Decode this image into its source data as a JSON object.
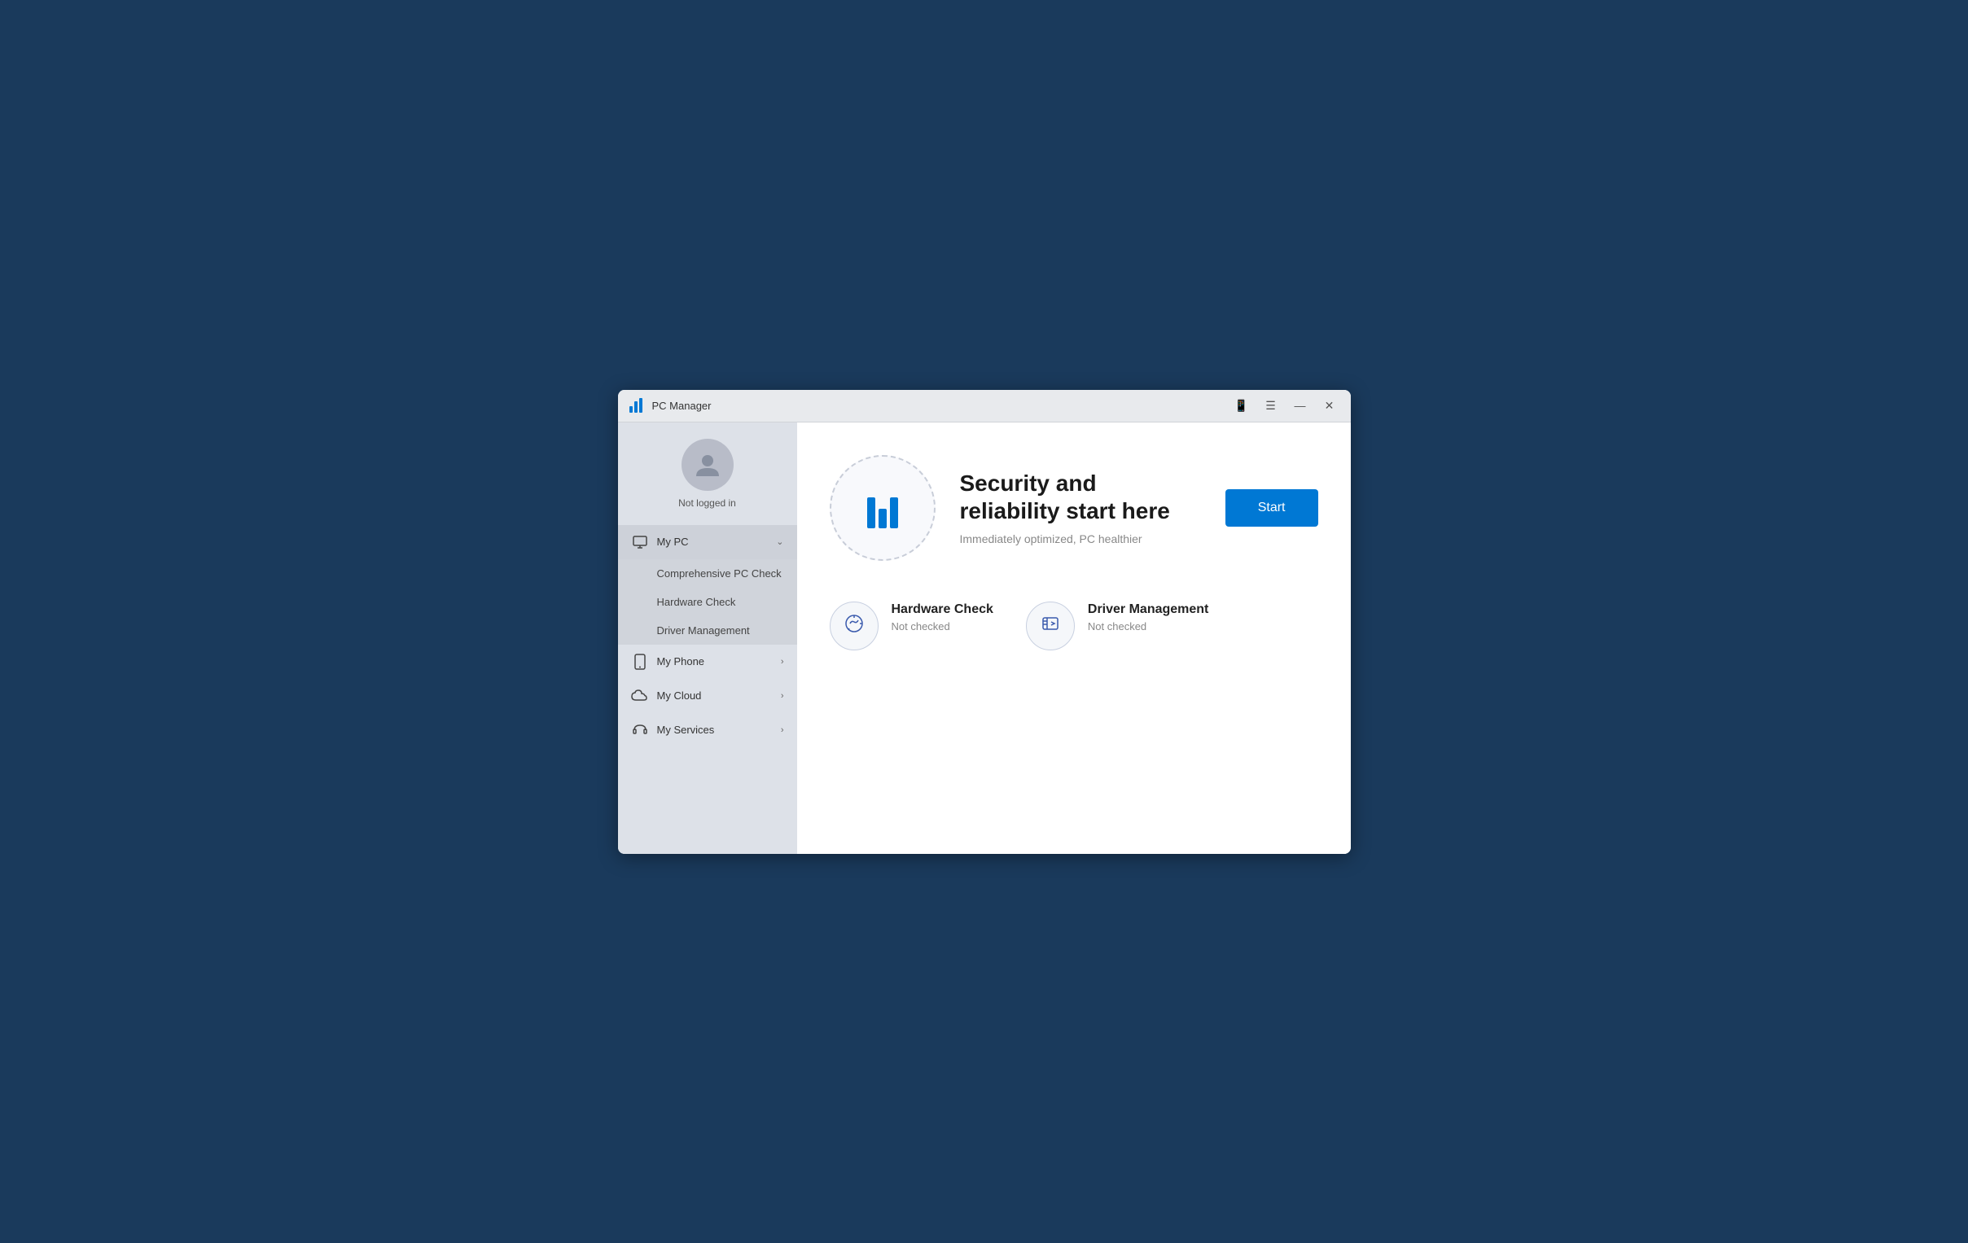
{
  "titlebar": {
    "logo_label": "PC Manager",
    "controls": {
      "phone_label": "📱",
      "menu_label": "☰",
      "minimize_label": "—",
      "close_label": "✕"
    }
  },
  "sidebar": {
    "user": {
      "status": "Not logged in"
    },
    "items": [
      {
        "id": "my-pc",
        "label": "My PC",
        "expanded": true,
        "sub_items": [
          {
            "id": "comprehensive-pc-check",
            "label": "Comprehensive PC Check",
            "active": false
          },
          {
            "id": "hardware-check",
            "label": "Hardware Check",
            "active": false
          },
          {
            "id": "driver-management",
            "label": "Driver Management",
            "active": false
          }
        ]
      },
      {
        "id": "my-phone",
        "label": "My Phone",
        "expanded": false
      },
      {
        "id": "my-cloud",
        "label": "My Cloud",
        "expanded": false
      },
      {
        "id": "my-services",
        "label": "My Services",
        "expanded": false
      }
    ]
  },
  "content": {
    "hero": {
      "title": "Security and reliability start here",
      "subtitle": "Immediately optimized, PC healthier",
      "start_button": "Start"
    },
    "cards": [
      {
        "id": "hardware-check",
        "title": "Hardware Check",
        "status": "Not checked"
      },
      {
        "id": "driver-management",
        "title": "Driver Management",
        "status": "Not checked"
      }
    ]
  }
}
